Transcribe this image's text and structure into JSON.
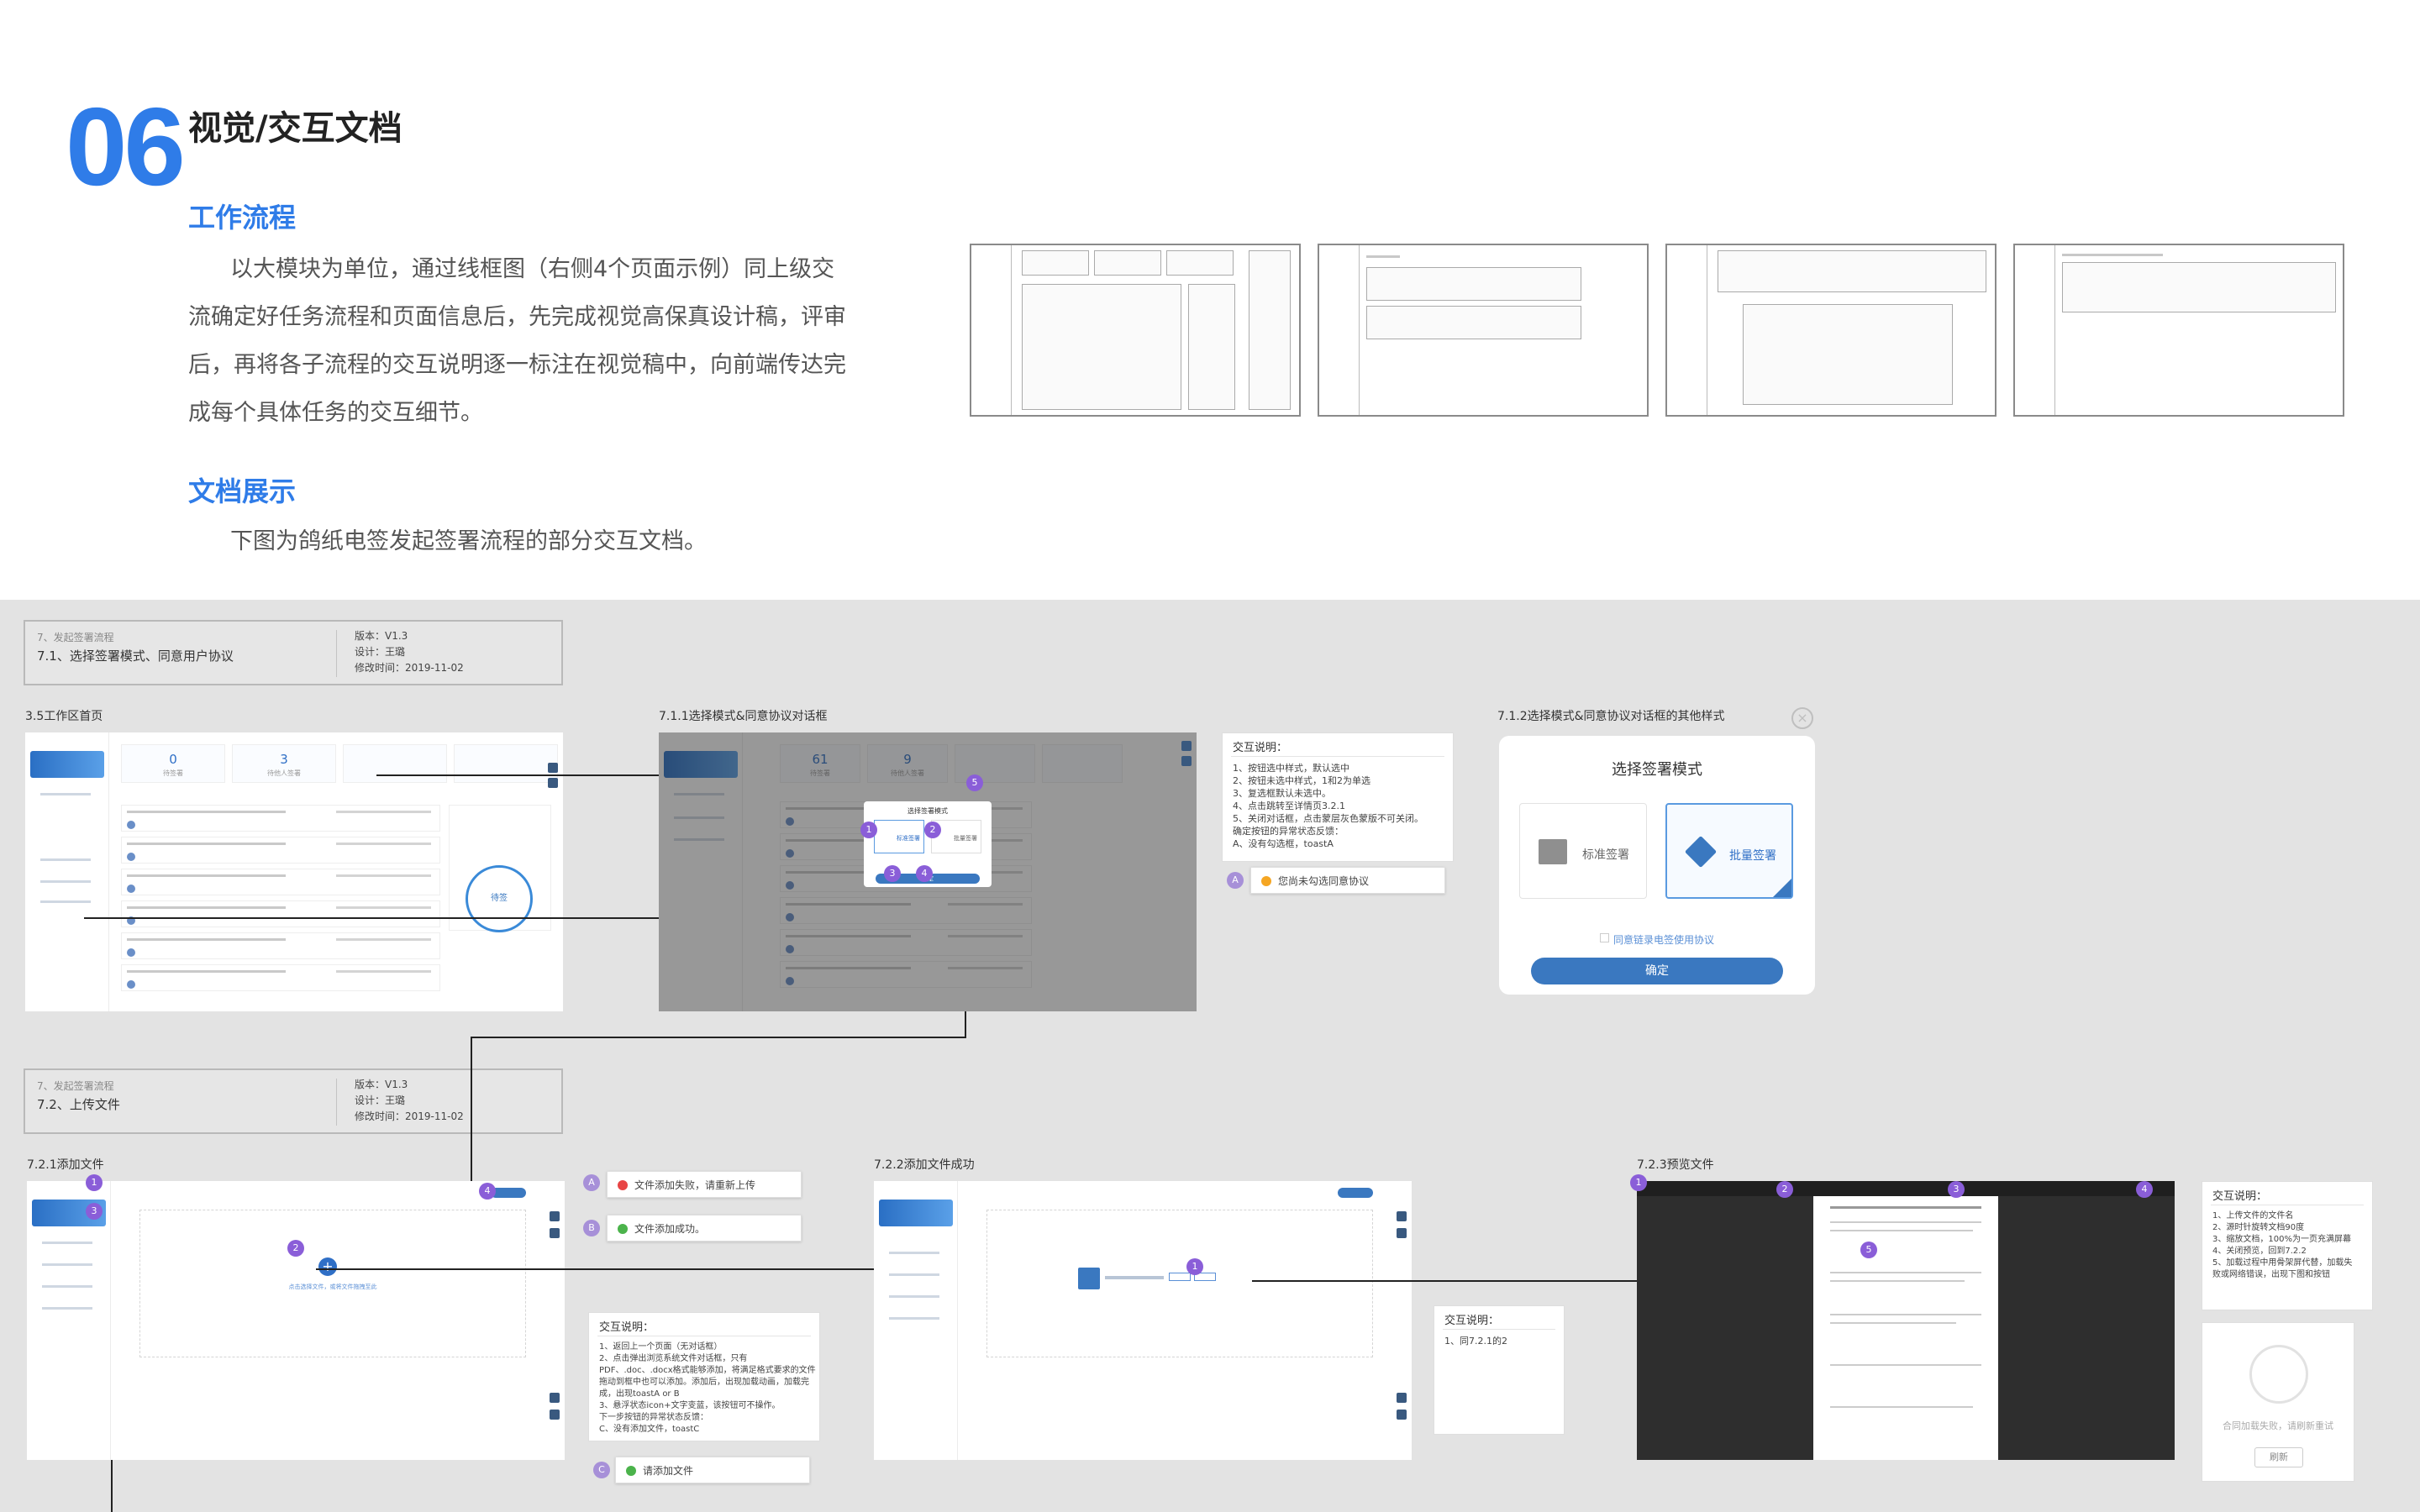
{
  "header": {
    "number": "06",
    "title": "视觉/交互文档",
    "workflow_title": "工作流程",
    "workflow_text": [
      "以大模块为单位，通过线框图（右侧4个页面示例）同上级交",
      "流确定好任务流程和页面信息后，先完成视觉高保真设计稿，评审",
      "后，再将各子流程的交互说明逐一标注在视觉稿中，向前端传达完",
      "成每个具体任务的交互细节。"
    ],
    "doc_title": "文档展示",
    "doc_text": "下图为鸽纸电签发起签署流程的部分交互文档。"
  },
  "version_boxes": [
    {
      "parent": "7、发起签署流程",
      "title": "7.1、选择签署模式、同意用户协议",
      "version": "版本：V1.3",
      "designer": "设计：王璐",
      "date": "修改时间：2019-11-02"
    },
    {
      "parent": "7、发起签署流程",
      "title": "7.2、上传文件",
      "version": "版本：V1.3",
      "designer": "设计：王璐",
      "date": "修改时间：2019-11-02"
    }
  ],
  "labels": {
    "home": "3.5工作区首页",
    "dialog": "7.1.1选择模式&同意协议对话框",
    "dialog_other": "7.1.2选择模式&同意协议对话框的其他样式",
    "add_file": "7.2.1添加文件",
    "add_success": "7.2.2添加文件成功",
    "preview": "7.2.3预览文件"
  },
  "home_screen": {
    "stats": [
      {
        "n": "0",
        "s": "待签署"
      },
      {
        "n": "3",
        "s": "待他人签署"
      }
    ],
    "ring": "待签"
  },
  "dialog_screen": {
    "stats": [
      {
        "n": "61",
        "s": "待签署"
      },
      {
        "n": "9",
        "s": "待他人签署"
      }
    ],
    "title": "选择签署模式",
    "opt1": "标准签署",
    "opt2": "批量签署",
    "confirm": "确定"
  },
  "notes": {
    "n1": {
      "head": "交互说明：",
      "lines": [
        "1、按钮选中样式，默认选中",
        "2、按钮未选中样式，1和2为单选",
        "3、复选框默认未选中。",
        "4、点击跳转至详情页3.2.1",
        "5、关闭对话框，点击蒙层灰色蒙版不可关闭。",
        "确定按钮的异常状态反馈：",
        "A、没有勾选框，toastA"
      ]
    },
    "n2": {
      "head": "交互说明：",
      "lines": [
        "1、返回上一个页面（无对话框）",
        "2、点击弹出浏览系统文件对话框，只有",
        "PDF、.doc、.docx格式能够添加，将满足格式要求的文件",
        "拖动到框中也可以添加。添加后，出现加载动画，加载完",
        "成，出现toastA or B",
        "3、悬浮状态icon+文字变蓝，该按钮可不操作。",
        "下一步按钮的异常状态反馈：",
        "C、没有添加文件，toastC"
      ]
    },
    "n3": {
      "head": "交互说明：",
      "lines": [
        "1、同7.2.1的2"
      ]
    },
    "n4": {
      "head": "交互说明：",
      "lines": [
        "1、上传文件的文件名",
        "2、源时针旋转文档90度",
        "3、缩放文档，100%为一页充满屏幕",
        "4、关闭预览，回到7.2.2",
        "5、加载过程中用骨架屏代替，加载失",
        "败或网络错误，出现下图和按钮"
      ]
    }
  },
  "toasts": {
    "a1": {
      "marker": "A",
      "text": "您尚未勾选同意协议",
      "color": "#f5a623"
    },
    "a2": {
      "marker": "A",
      "text": "文件添加失败，请重新上传",
      "color": "#e84545"
    },
    "b": {
      "marker": "B",
      "text": "文件添加成功。",
      "color": "#4bb34b"
    },
    "c": {
      "marker": "C",
      "text": "请添加文件",
      "color": "#4bb34b"
    }
  },
  "dialog2": {
    "title": "选择签署模式",
    "opt1": "标准签署",
    "opt2": "批量签署",
    "agree": "同意链录电签使用协议",
    "confirm": "确定"
  },
  "error_panel": {
    "text": "合同加载失败，请刷新重试",
    "button": "刷新"
  },
  "upload": {
    "hint": "点击选择文件，或将文件拖拽至此"
  },
  "markers": [
    "1",
    "2",
    "3",
    "4",
    "5"
  ],
  "colors": {
    "accent": "#2f7ce8",
    "canvas": "#e3e3e3",
    "marker": "#8a5ed8"
  }
}
